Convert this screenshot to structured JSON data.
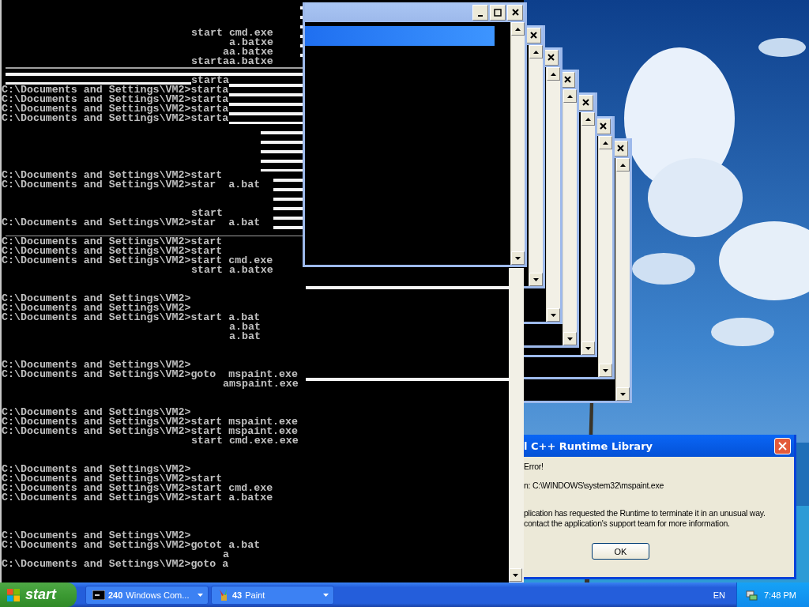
{
  "console": {
    "lines": [
      {
        "text": "start cmd.exe"
      },
      {
        "text": "a.batxe"
      },
      {
        "text": "aa.batxe"
      },
      {
        "text": "startaa.batxe"
      },
      {
        "text": "starta"
      },
      {
        "text": "C:\\Documents and Settings\\VM2>starta"
      },
      {
        "text": "C:\\Documents and Settings\\VM2>starta"
      },
      {
        "text": "C:\\Documents and Settings\\VM2>starta"
      },
      {
        "text": "C:\\Documents and Settings\\VM2>starta"
      },
      {
        "text": "C:\\Documents and Settings\\VM2>start"
      },
      {
        "text": "C:\\Documents and Settings\\VM2>star  a.bat"
      },
      {
        "text": "start"
      },
      {
        "text": "C:\\Documents and Settings\\VM2>star  a.bat"
      },
      {
        "text": "C:\\Documents and Settings\\VM2>start"
      },
      {
        "text": "C:\\Documents and Settings\\VM2>start"
      },
      {
        "text": "C:\\Documents and Settings\\VM2>start cmd.exe"
      },
      {
        "text": "start a.batxe"
      },
      {
        "text": "C:\\Documents and Settings\\VM2>"
      },
      {
        "text": "C:\\Documents and Settings\\VM2>"
      },
      {
        "text": "C:\\Documents and Settings\\VM2>start a.bat"
      },
      {
        "text": "a.bat"
      },
      {
        "text": "a.bat"
      },
      {
        "text": "C:\\Documents and Settings\\VM2>"
      },
      {
        "text": "C:\\Documents and Settings\\VM2>goto  mspaint.exe"
      },
      {
        "text": "amspaint.exe"
      },
      {
        "text": "C:\\Documents and Settings\\VM2>"
      },
      {
        "text": "C:\\Documents and Settings\\VM2>start mspaint.exe"
      },
      {
        "text": "C:\\Documents and Settings\\VM2>start mspaint.exe"
      },
      {
        "text": "start cmd.exe.exe"
      },
      {
        "text": "C:\\Documents and Settings\\VM2>"
      },
      {
        "text": "C:\\Documents and Settings\\VM2>start"
      },
      {
        "text": "C:\\Documents and Settings\\VM2>start cmd.exe"
      },
      {
        "text": "C:\\Documents and Settings\\VM2>start a.batxe"
      },
      {
        "text": "C:\\Documents and Settings\\VM2>"
      },
      {
        "text": "C:\\Documents and Settings\\VM2>gotot a.bat"
      },
      {
        "text": "a"
      },
      {
        "text": "C:\\Documents and Settings\\VM2>goto a"
      }
    ]
  },
  "dialog": {
    "title": "l C++ Runtime Library",
    "lines": [
      {
        "text": "Error!"
      },
      {
        "text": "n: C:\\WINDOWS\\system32\\mspaint.exe"
      },
      {
        "text": "plication has requested the Runtime to terminate it in an unusual way."
      },
      {
        "text": "contact the application's support team for more information."
      }
    ],
    "button": "OK"
  },
  "taskbar": {
    "start": "start",
    "tasks": [
      {
        "kind": "console",
        "count": "240",
        "label": "Windows Com..."
      },
      {
        "kind": "paint",
        "count": "43",
        "label": "Paint"
      }
    ],
    "language": "EN",
    "clock": "7:48 PM"
  }
}
